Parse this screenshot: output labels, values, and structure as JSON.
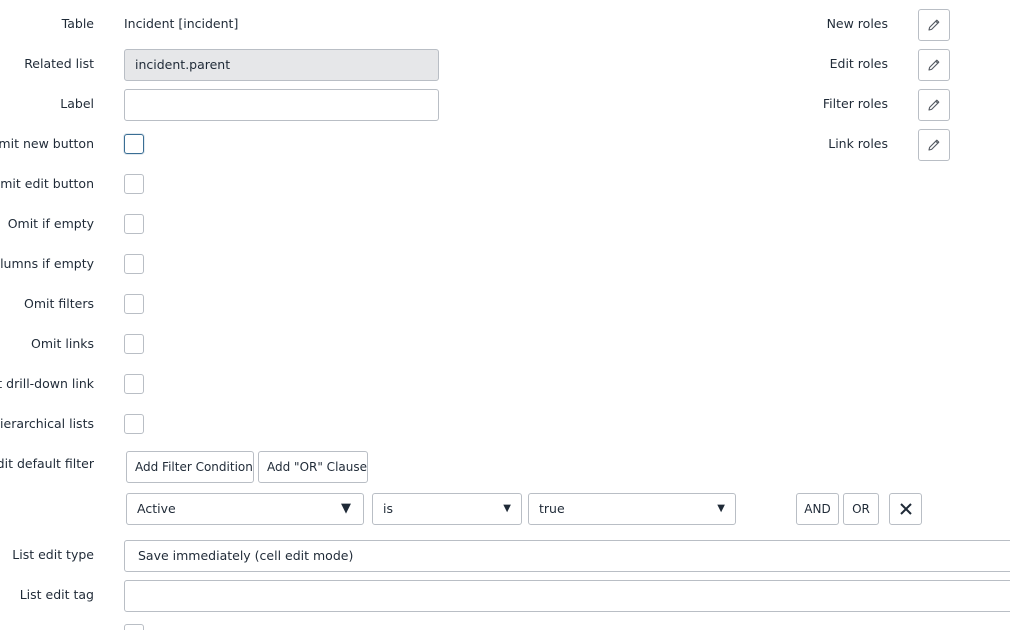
{
  "form": {
    "table": {
      "label": "Table",
      "value": "Incident [incident]"
    },
    "related_list": {
      "label": "Related list",
      "value": "incident.parent"
    },
    "label_field": {
      "label": "Label",
      "value": ""
    },
    "omit_new_button": {
      "label": "Omit new button",
      "checked": false
    },
    "omit_edit_button": {
      "label": "Omit edit button",
      "checked": false
    },
    "omit_if_empty": {
      "label": "Omit if empty",
      "checked": false
    },
    "omit_columns_if_empty": {
      "label": "Omit columns if empty",
      "checked": false
    },
    "omit_filters": {
      "label": "Omit filters",
      "checked": false
    },
    "omit_links": {
      "label": "Omit links",
      "checked": false
    },
    "omit_drilldown_link": {
      "label": "Omit drill-down link",
      "checked": false
    },
    "hierarchical_lists": {
      "label": "Hierarchical lists",
      "checked": false
    },
    "edit_default_filter": {
      "label": "Edit default filter",
      "add_condition_label": "Add Filter Condition",
      "add_or_label": "Add \"OR\" Clause",
      "condition": {
        "field": "Active",
        "operator": "is",
        "value": "true"
      },
      "and_label": "AND",
      "or_label": "OR"
    },
    "list_edit_type": {
      "label": "List edit type",
      "value": "Save immediately (cell edit mode)"
    },
    "list_edit_tag": {
      "label": "List edit tag",
      "value": ""
    }
  },
  "roles": {
    "new_roles": "New roles",
    "edit_roles": "Edit roles",
    "filter_roles": "Filter roles",
    "link_roles": "Link roles"
  },
  "icons": {
    "edit": "pencil-icon",
    "remove": "close-icon",
    "dropdown": "caret-down-icon"
  },
  "colors": {
    "border": "#b9bec5",
    "readonly_bg": "#e6e7e9",
    "focus_border": "#3a6e94",
    "text": "#1f2a37"
  }
}
